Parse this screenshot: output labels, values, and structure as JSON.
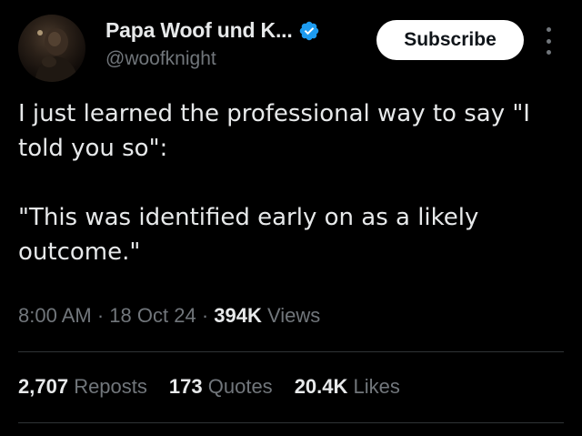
{
  "author": {
    "display_name": "Papa Woof und K...",
    "handle": "@woofknight",
    "verified": true,
    "verified_color": "#1d9bf0"
  },
  "subscribe_button": {
    "label": "Subscribe"
  },
  "tweet": {
    "text_line_1": "I just learned the professional way to say \"I told you so\":",
    "text_line_2": "\"This was identified early on as a likely outcome.\""
  },
  "meta": {
    "time": "8:00 AM",
    "separator": "·",
    "date": "18 Oct 24",
    "views_count": "394K",
    "views_label": "Views"
  },
  "stats": {
    "reposts_count": "2,707",
    "reposts_label": "Reposts",
    "quotes_count": "173",
    "quotes_label": "Quotes",
    "likes_count": "20.4K",
    "likes_label": "Likes"
  },
  "icons": {
    "verified": "verified-badge-icon",
    "more": "more-vertical-icon"
  },
  "colors": {
    "background": "#000000",
    "primary_text": "#e7e9ea",
    "secondary_text": "#71767b",
    "divider": "#2f3336"
  }
}
